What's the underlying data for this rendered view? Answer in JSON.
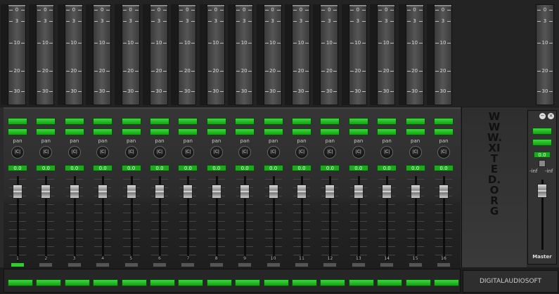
{
  "meter_scale": [
    "0",
    "3",
    "10",
    "20",
    "30"
  ],
  "master_scale": [
    "0",
    "3",
    "10",
    "20",
    "30"
  ],
  "channels": [
    {
      "number": "1",
      "pan_label": "pan",
      "knob_label": "|C|",
      "value": "0.0",
      "active": true
    },
    {
      "number": "2",
      "pan_label": "pan",
      "knob_label": "|C|",
      "value": "0.0",
      "active": false
    },
    {
      "number": "3",
      "pan_label": "pan",
      "knob_label": "|C|",
      "value": "0.0",
      "active": false
    },
    {
      "number": "4",
      "pan_label": "pan",
      "knob_label": "|C|",
      "value": "0.0",
      "active": false
    },
    {
      "number": "5",
      "pan_label": "pan",
      "knob_label": "|C|",
      "value": "0.0",
      "active": false
    },
    {
      "number": "6",
      "pan_label": "pan",
      "knob_label": "|C|",
      "value": "0.0",
      "active": false
    },
    {
      "number": "7",
      "pan_label": "pan",
      "knob_label": "|C|",
      "value": "0.0",
      "active": false
    },
    {
      "number": "8",
      "pan_label": "pan",
      "knob_label": "|C|",
      "value": "0.0",
      "active": false
    },
    {
      "number": "9",
      "pan_label": "pan",
      "knob_label": "|C|",
      "value": "0.0",
      "active": false
    },
    {
      "number": "10",
      "pan_label": "pan",
      "knob_label": "|C|",
      "value": "0.0",
      "active": false
    },
    {
      "number": "11",
      "pan_label": "pan",
      "knob_label": "|C|",
      "value": "0.0",
      "active": false
    },
    {
      "number": "12",
      "pan_label": "pan",
      "knob_label": "|C|",
      "value": "0.0",
      "active": false
    },
    {
      "number": "13",
      "pan_label": "pan",
      "knob_label": "|C|",
      "value": "0.0",
      "active": false
    },
    {
      "number": "14",
      "pan_label": "pan",
      "knob_label": "|C|",
      "value": "0.0",
      "active": false
    },
    {
      "number": "15",
      "pan_label": "pan",
      "knob_label": "|C|",
      "value": "0.0",
      "active": false
    },
    {
      "number": "16",
      "pan_label": "pan",
      "knob_label": "|C|",
      "value": "0.0",
      "active": false
    }
  ],
  "logo": {
    "text": "WWW.XITED.ORG"
  },
  "master": {
    "label": "Master",
    "value": "0.0",
    "left_label": "-inf",
    "right_label": "-inf",
    "minimize_icon": "minimize-icon",
    "close_icon": "close-icon"
  },
  "brand": "DIGITALAUDIOSOFT",
  "colors": {
    "led_green": "#2cd12c",
    "background": "#1b1b1b"
  }
}
